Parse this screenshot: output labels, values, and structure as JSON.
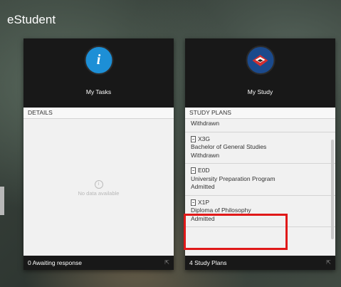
{
  "app": {
    "title": "eStudent"
  },
  "tasks": {
    "name": "My Tasks",
    "icon_glyph": "i",
    "section": "DETAILS",
    "empty_text": "No data available",
    "footer": "0 Awaiting response",
    "accent": "#1d8fd6"
  },
  "study": {
    "name": "My Study",
    "section": "STUDY PLANS",
    "partial_status": "Withdrawn",
    "plans": [
      {
        "code": "X3G",
        "title": "Bachelor of General Studies",
        "status": "Withdrawn"
      },
      {
        "code": "E0D",
        "title": "University Preparation Program",
        "status": "Admitted"
      },
      {
        "code": "X1P",
        "title": "Diploma of Philosophy",
        "status": "Admitted"
      }
    ],
    "footer": "4 Study Plans",
    "accent": "#1b4a8c"
  },
  "highlight_color": "#e01919"
}
